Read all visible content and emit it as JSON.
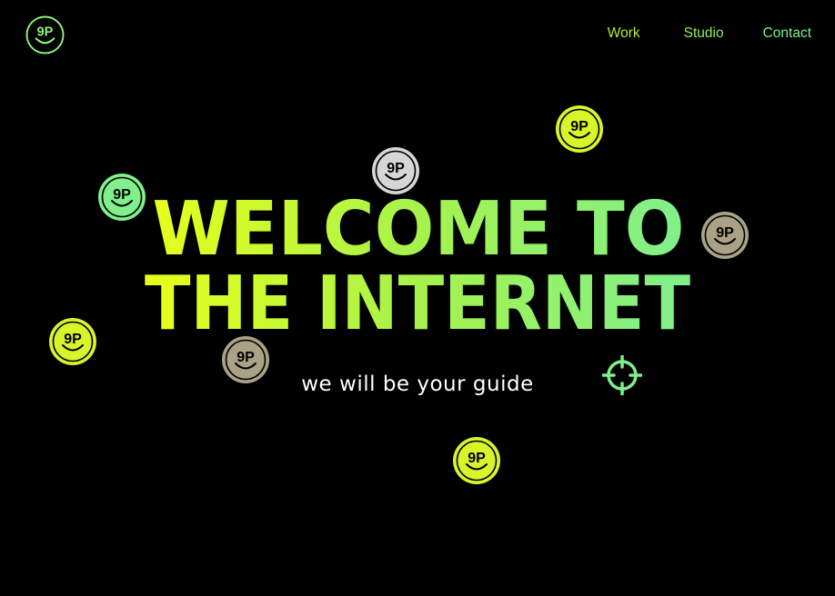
{
  "header": {
    "logo_text": "9P",
    "logo_icon": "smiley-9p-logo-icon",
    "logo_color": "#8ef07a"
  },
  "nav": {
    "items": [
      {
        "label": "Work",
        "color": "#b4f02c"
      },
      {
        "label": "Studio",
        "color": "#8ef059"
      },
      {
        "label": "Contact",
        "color": "#7ff08c"
      }
    ]
  },
  "hero": {
    "headline_line1": "WELCOME TO",
    "headline_line2": "THE INTERNET",
    "gradient_start": "#e8ff1a",
    "gradient_end": "#7ff08c",
    "tagline": "we will be your guide"
  },
  "badges": [
    {
      "text": "9P",
      "fill": "#d8f52a",
      "ring": "#d8f52a"
    },
    {
      "text": "9P",
      "fill": "#d6d6d6",
      "ring": "#bcbcbc"
    },
    {
      "text": "9P",
      "fill": "#7ff08c",
      "ring": "#7ff08c"
    },
    {
      "text": "9P",
      "fill": "#a9a287",
      "ring": "#928b70"
    },
    {
      "text": "9P",
      "fill": "#d8f52a",
      "ring": "#d8f52a"
    },
    {
      "text": "9P",
      "fill": "#a9a287",
      "ring": "#928b70"
    },
    {
      "text": "9P",
      "fill": "#d8f52a",
      "ring": "#d8f52a"
    }
  ],
  "cursor": {
    "icon": "crosshair-icon",
    "color": "#7ff08c"
  }
}
